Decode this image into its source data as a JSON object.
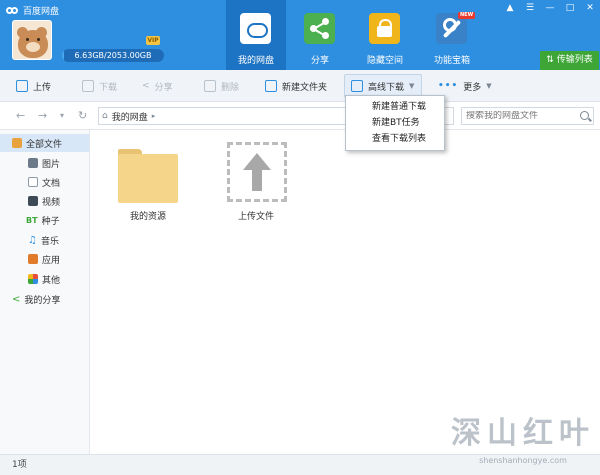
{
  "app": {
    "title": "百度网盘"
  },
  "user": {
    "quota_text": "6.63GB/2053.00GB",
    "quota_fraction": 0.0032,
    "vip_badge": "VIP"
  },
  "nav": {
    "tabs": [
      {
        "label": "我的网盘",
        "icon": "cloud-icon",
        "active": true
      },
      {
        "label": "分享",
        "icon": "share-icon",
        "active": false
      },
      {
        "label": "隐藏空间",
        "icon": "lock-icon",
        "active": false
      },
      {
        "label": "功能宝箱",
        "icon": "tools-icon",
        "active": false,
        "badge": "NEW"
      }
    ],
    "transfer_label": "传输列表"
  },
  "window_controls": [
    "bell-icon",
    "menu-icon",
    "minimize-icon",
    "maximize-icon",
    "close-icon"
  ],
  "toolbar": {
    "upload": "上传",
    "download": "下载",
    "share": "分享",
    "delete": "删除",
    "new_folder": "新建文件夹",
    "offline_download": "高线下载",
    "more": "更多"
  },
  "address": {
    "breadcrumb": "我的网盘",
    "search_placeholder": "搜索我的网盘文件"
  },
  "sidebar": {
    "items": [
      {
        "label": "全部文件",
        "icon": "all-files-icon",
        "active": true
      },
      {
        "label": "图片",
        "icon": "image-icon"
      },
      {
        "label": "文档",
        "icon": "document-icon"
      },
      {
        "label": "视频",
        "icon": "video-icon"
      },
      {
        "label": "种子",
        "icon": "torrent-icon",
        "icon_text": "BT"
      },
      {
        "label": "音乐",
        "icon": "music-icon"
      },
      {
        "label": "应用",
        "icon": "app-icon"
      },
      {
        "label": "其他",
        "icon": "other-icon"
      },
      {
        "label": "我的分享",
        "icon": "my-share-icon"
      }
    ]
  },
  "content": {
    "folder_name": "我的资源",
    "upload_label": "上传文件"
  },
  "dropdown": {
    "items": [
      "新建普通下载",
      "新建BT任务",
      "查看下载列表"
    ]
  },
  "status": {
    "count": "1项"
  },
  "watermark": {
    "cn": "深山红叶",
    "en": "shenshanhongye.com"
  },
  "colors": {
    "header": "#2e8fe0",
    "active_tab": "#1e74c4",
    "transfer_green": "#3da637",
    "folder": "#f5d58a"
  }
}
